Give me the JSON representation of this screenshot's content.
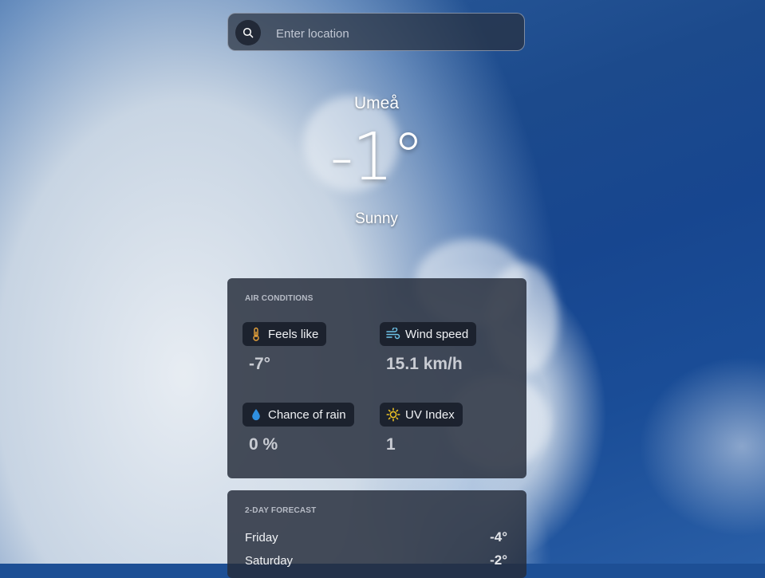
{
  "search": {
    "placeholder": "Enter location",
    "value": ""
  },
  "weather": {
    "city": "Umeå",
    "temperature": "-1°",
    "condition": "Sunny"
  },
  "air_conditions": {
    "title": "AIR CONDITIONS",
    "items": [
      {
        "label": "Feels like",
        "value": "-7°",
        "icon": "thermometer-icon",
        "icon_color": "#e8a33a"
      },
      {
        "label": "Wind speed",
        "value": "15.1 km/h",
        "icon": "wind-icon",
        "icon_color": "#6ec3e8"
      },
      {
        "label": "Chance of rain",
        "value": "0 %",
        "icon": "water-drop-icon",
        "icon_color": "#2f8fe0"
      },
      {
        "label": "UV Index",
        "value": "1",
        "icon": "sun-icon",
        "icon_color": "#f2c624"
      }
    ]
  },
  "forecast": {
    "title": "2-DAY FORECAST",
    "days": [
      {
        "day": "Friday",
        "temp": "-4°"
      },
      {
        "day": "Saturday",
        "temp": "-2°"
      }
    ]
  }
}
